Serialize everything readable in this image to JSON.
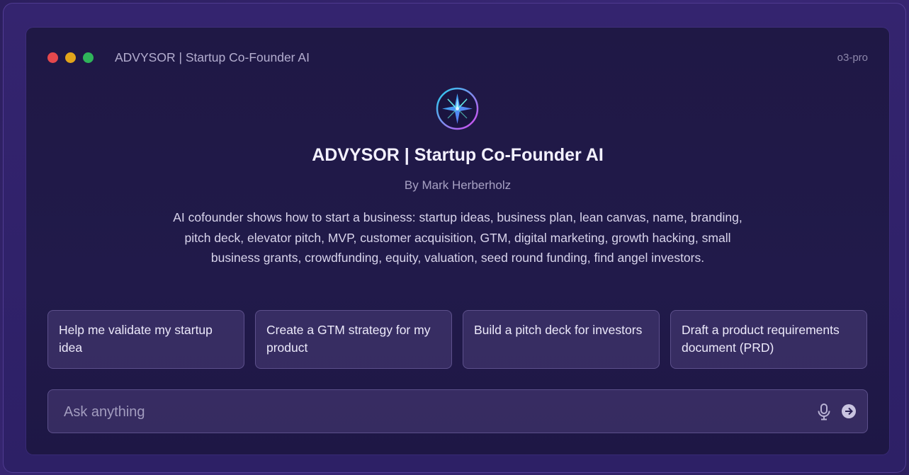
{
  "window": {
    "title": "ADVYSOR | Startup Co-Founder AI",
    "model": "o3-pro"
  },
  "logo": {
    "icon": "compass-star-icon"
  },
  "header": {
    "title": "ADVYSOR | Startup Co-Founder AI",
    "author": "By Mark Herberholz",
    "description": "AI cofounder shows how to start a business: startup ideas, business plan, lean canvas, name, branding, pitch deck, elevator pitch, MVP, customer acquisition, GTM, digital marketing, growth hacking, small business grants, crowdfunding, equity, valuation, seed round funding, find angel investors."
  },
  "suggestions": [
    {
      "label": "Help me validate my startup idea"
    },
    {
      "label": "Create a GTM strategy for my product"
    },
    {
      "label": "Build a pitch deck for investors"
    },
    {
      "label": "Draft a product requirements document (PRD)"
    }
  ],
  "composer": {
    "placeholder": "Ask anything",
    "value": ""
  },
  "colors": {
    "close": "#e5484d",
    "minimize": "#e2a41b",
    "maximize": "#2fb45a",
    "accent_cyan": "#22d3ee",
    "accent_magenta": "#d946ef"
  }
}
